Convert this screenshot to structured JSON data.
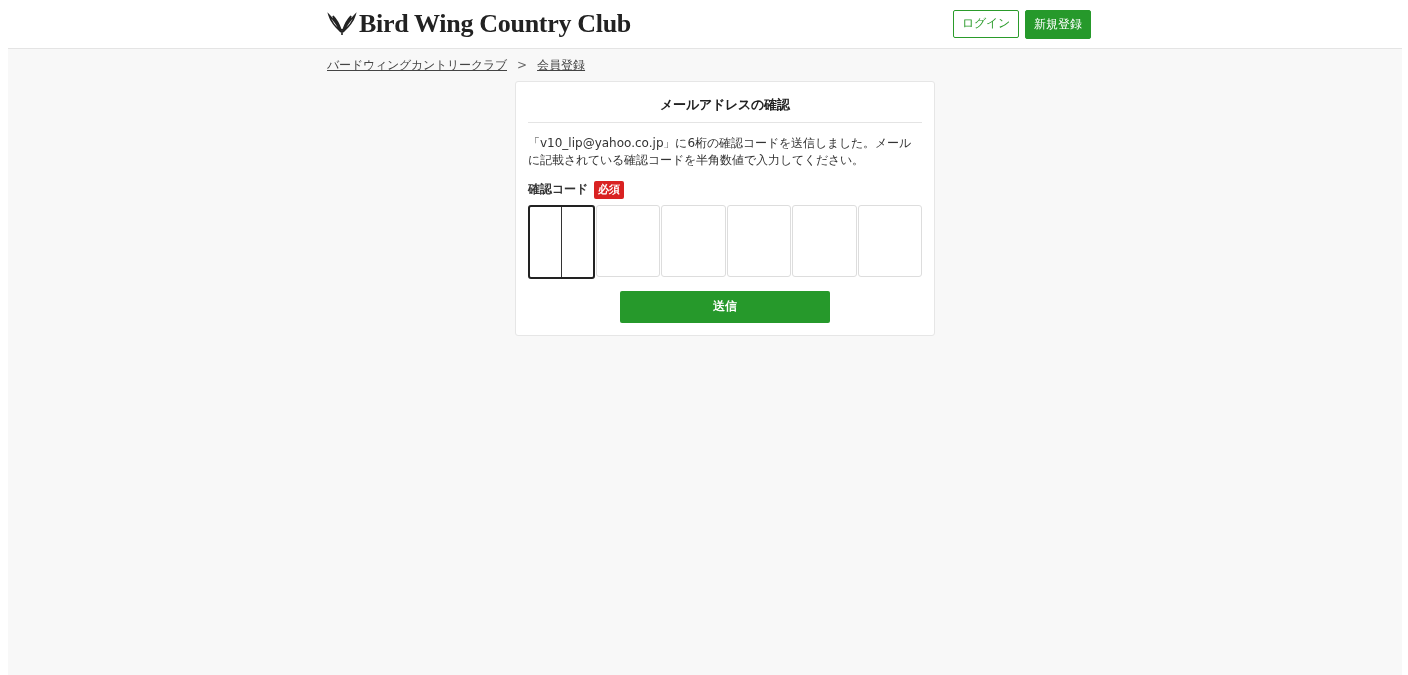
{
  "header": {
    "logo": "Bird Wing Country Club",
    "buttons": [
      {
        "label": "ログイン",
        "kind": "outline"
      },
      {
        "label": "新規登録",
        "kind": "filled"
      }
    ]
  },
  "breadcrumb": [
    {
      "label": "バードウィングカントリークラブ",
      "kind": "link"
    },
    {
      "label": ">",
      "kind": "separator"
    },
    {
      "label": "会員登録",
      "kind": "link"
    }
  ],
  "card": {
    "title": "メールアドレスの確認",
    "message": "「v10_lip@yahoo.co.jp」に6桁の確認コードを送信しました。メールに記載されている確認コードを半角数値で入力してください。",
    "field_label": "確認コード",
    "required_badge": "必須",
    "code_boxes": [
      {
        "focused": true
      },
      {
        "focused": false
      },
      {
        "focused": false
      },
      {
        "focused": false
      },
      {
        "focused": false
      },
      {
        "focused": false
      }
    ],
    "submit": "送信"
  }
}
